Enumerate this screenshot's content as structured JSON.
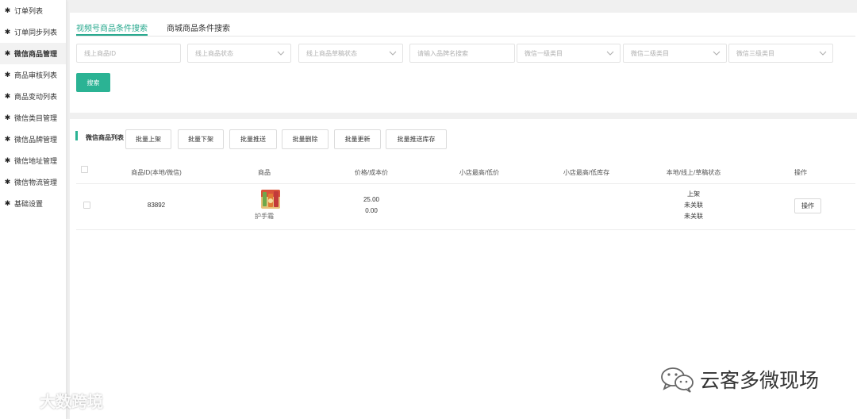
{
  "sidebar": {
    "items": [
      {
        "label": "订单列表",
        "active": false
      },
      {
        "label": "订单同步列表",
        "active": false
      },
      {
        "label": "微信商品管理",
        "active": true
      },
      {
        "label": "商品审核列表",
        "active": false
      },
      {
        "label": "商品变动列表",
        "active": false
      },
      {
        "label": "微信类目管理",
        "active": false
      },
      {
        "label": "微信品牌管理",
        "active": false
      },
      {
        "label": "微信地址管理",
        "active": false
      },
      {
        "label": "微信物流管理",
        "active": false
      },
      {
        "label": "基础设置",
        "active": false
      }
    ]
  },
  "search": {
    "tabs": [
      {
        "label": "视频号商品条件搜索",
        "active": true
      },
      {
        "label": "商城商品条件搜索",
        "active": false
      }
    ],
    "fields": {
      "product_id": {
        "placeholder": "线上商品ID",
        "type": "input"
      },
      "product_status": {
        "placeholder": "线上商品状态",
        "type": "select"
      },
      "draft_status": {
        "placeholder": "线上商品草稿状态",
        "type": "select"
      },
      "brand_name": {
        "placeholder": "请输入品牌名搜索",
        "type": "input"
      },
      "cat1": {
        "placeholder": "微信一级类目",
        "type": "select"
      },
      "cat2": {
        "placeholder": "微信二级类目",
        "type": "select"
      },
      "cat3": {
        "placeholder": "微信三级类目",
        "type": "select"
      }
    },
    "search_button": "搜索"
  },
  "list": {
    "title": "微信商品列表",
    "batch_buttons": {
      "on_shelf": "批量上架",
      "off_shelf": "批量下架",
      "push": "批量推送",
      "delete": "批量删除",
      "update": "批量更新",
      "push_stock": "批量推送库存"
    },
    "columns": {
      "id": "商品ID(本地/微信)",
      "product": "商品",
      "price": "价格/成本价",
      "shop_price": "小店最高/低价",
      "shop_stock": "小店最高/低库存",
      "status": "本地/线上/草稿状态",
      "action": "操作"
    },
    "rows": [
      {
        "id": "83892",
        "product_name": "护手霜",
        "price": "25.00",
        "cost": "0.00",
        "shop_price": "",
        "shop_stock": "",
        "status_local": "上架",
        "status_online": "未关联",
        "status_draft": "未关联",
        "action": "操作"
      }
    ]
  },
  "watermarks": {
    "left": "大数跨境",
    "right": "云客多微现场"
  },
  "colors": {
    "accent": "#2bb394",
    "tab_active": "#26a88d"
  }
}
